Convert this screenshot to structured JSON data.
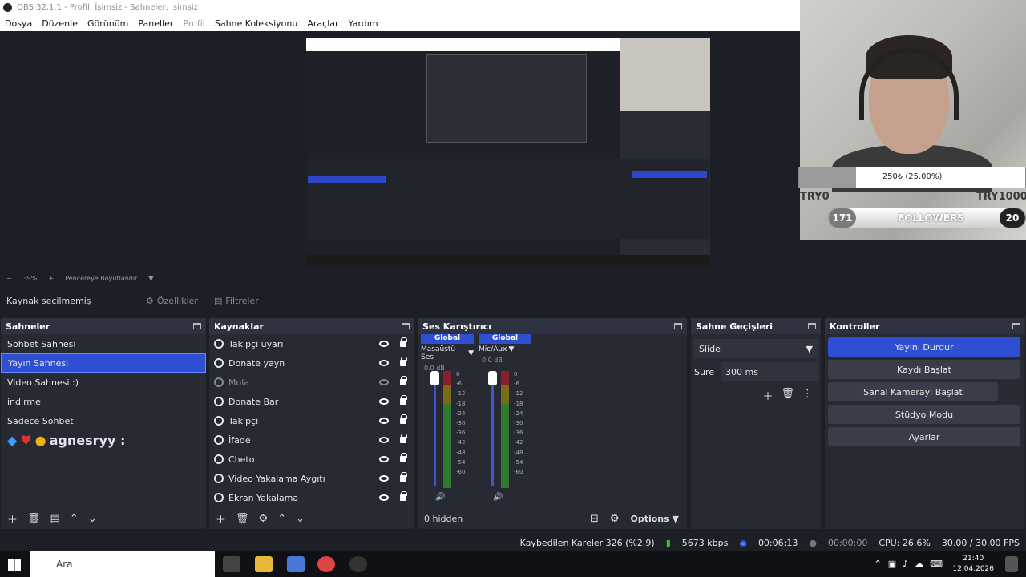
{
  "window": {
    "title": "OBS 32.1.1 - Profil: İsimsiz - Sahneler: İsimsiz"
  },
  "menu": [
    "Dosya",
    "Düzenle",
    "Görünüm",
    "Paneller",
    "Profil",
    "Sahne Koleksiyonu",
    "Araçlar",
    "Yardım"
  ],
  "overlay": {
    "donation_text": "250₺ (25.00%)",
    "donation_fraction": 0.25,
    "try_left": "TRY0",
    "try_right": "TRY1000",
    "followers_label": "FOLLOWERS",
    "followers_current": "171",
    "followers_goal": "20"
  },
  "preview": {
    "zoom": "39%",
    "fit_label": "Pencereye Boyutlandır"
  },
  "selection": {
    "no_source": "Kaynak seçilmemiş",
    "properties": "Özellikler",
    "filters": "Filtreler"
  },
  "scenes": {
    "title": "Sahneler",
    "items": [
      "Sohbet Sahnesi",
      "Yayın Sahnesi",
      "Video Sahnesi :)",
      "indirme",
      "Sadece Sohbet"
    ],
    "selected": 1,
    "chat_user": "agnesryy :"
  },
  "sources": {
    "title": "Kaynaklar",
    "items": [
      {
        "label": "Takipçi uyarı",
        "icon": "globe-icon",
        "visible": true
      },
      {
        "label": "Donate yayn",
        "icon": "globe-icon",
        "visible": true
      },
      {
        "label": "Mola",
        "icon": "text-icon",
        "visible": false
      },
      {
        "label": "Donate Bar",
        "icon": "globe-icon",
        "visible": true
      },
      {
        "label": "Takipçi",
        "icon": "globe-icon",
        "visible": true
      },
      {
        "label": "İfade",
        "icon": "globe-icon",
        "visible": true
      },
      {
        "label": "Cheto",
        "icon": "globe-icon",
        "visible": true
      },
      {
        "label": "Video Yakalama Aygıtı",
        "icon": "camera-icon",
        "visible": true
      },
      {
        "label": "Ekran Yakalama",
        "icon": "monitor-icon",
        "visible": true
      }
    ]
  },
  "mixer": {
    "title": "Ses Karıştırıcı",
    "channels": [
      {
        "global": "Global",
        "name": "Masaüstü Ses",
        "db": "0.0 dB"
      },
      {
        "global": "Global",
        "name": "Mic/Aux",
        "db": "0.0 dB"
      }
    ],
    "scale": [
      "0",
      "-6",
      "-12",
      "-18",
      "-24",
      "-30",
      "-36",
      "-42",
      "-48",
      "-54",
      "-60"
    ],
    "hidden": "0 hidden",
    "options": "Options"
  },
  "transitions": {
    "title": "Sahne Geçişleri",
    "type": "Slide",
    "duration_label": "Süre",
    "duration": "300 ms"
  },
  "controls": {
    "title": "Kontroller",
    "buttons": [
      "Yayını Durdur",
      "Kaydı Başlat",
      "Sanal Kamerayı Başlat",
      "Stüdyo Modu",
      "Ayarlar"
    ]
  },
  "status": {
    "dropped": "Kaybedilen Kareler 326 (%2.9)",
    "bitrate": "5673 kbps",
    "stream_time": "00:06:13",
    "rec_time": "00:00:00",
    "cpu": "CPU: 26.6%",
    "fps": "30.00 / 30.00 FPS"
  },
  "taskbar": {
    "search_placeholder": "Ara",
    "time": "21:40",
    "date": "12.04.2026"
  },
  "colors": {
    "accent": "#2f4fd3",
    "panel": "#272a33",
    "background": "#1d1f26"
  }
}
